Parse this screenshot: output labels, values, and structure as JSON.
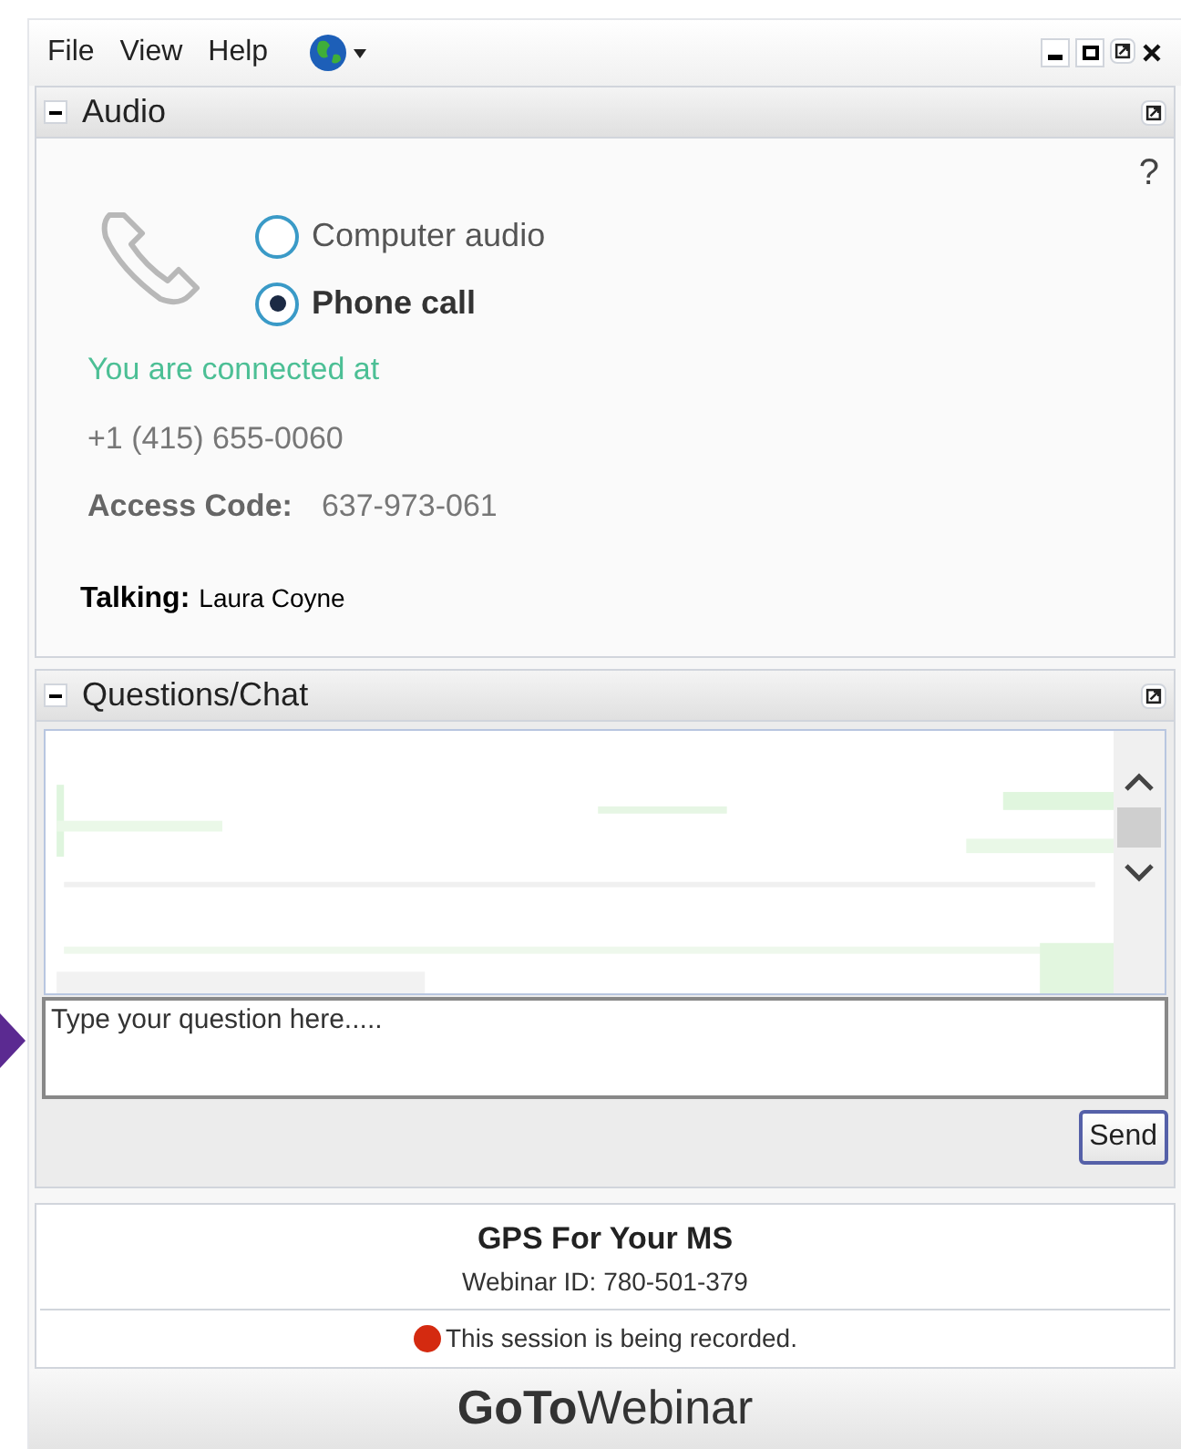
{
  "menu": [
    "File",
    "View",
    "Help"
  ],
  "audio": {
    "title": "Audio",
    "help": "?",
    "options": [
      {
        "label": "Computer audio",
        "selected": false
      },
      {
        "label": "Phone call",
        "selected": true
      }
    ],
    "status": "You are connected at",
    "phone": "+1 (415) 655-0060",
    "access_label": "Access Code:",
    "access_code": "637-973-061",
    "talking_label": "Talking:",
    "talking_name": "Laura Coyne"
  },
  "chat": {
    "title": "Questions/Chat",
    "placeholder": "Type your question here.....",
    "send": "Send"
  },
  "footer": {
    "title": "GPS For Your MS",
    "webinar_id": "Webinar ID: 780-501-379",
    "recording": "This session is being recorded.",
    "logo": "**GoTo**Webinar"
  }
}
